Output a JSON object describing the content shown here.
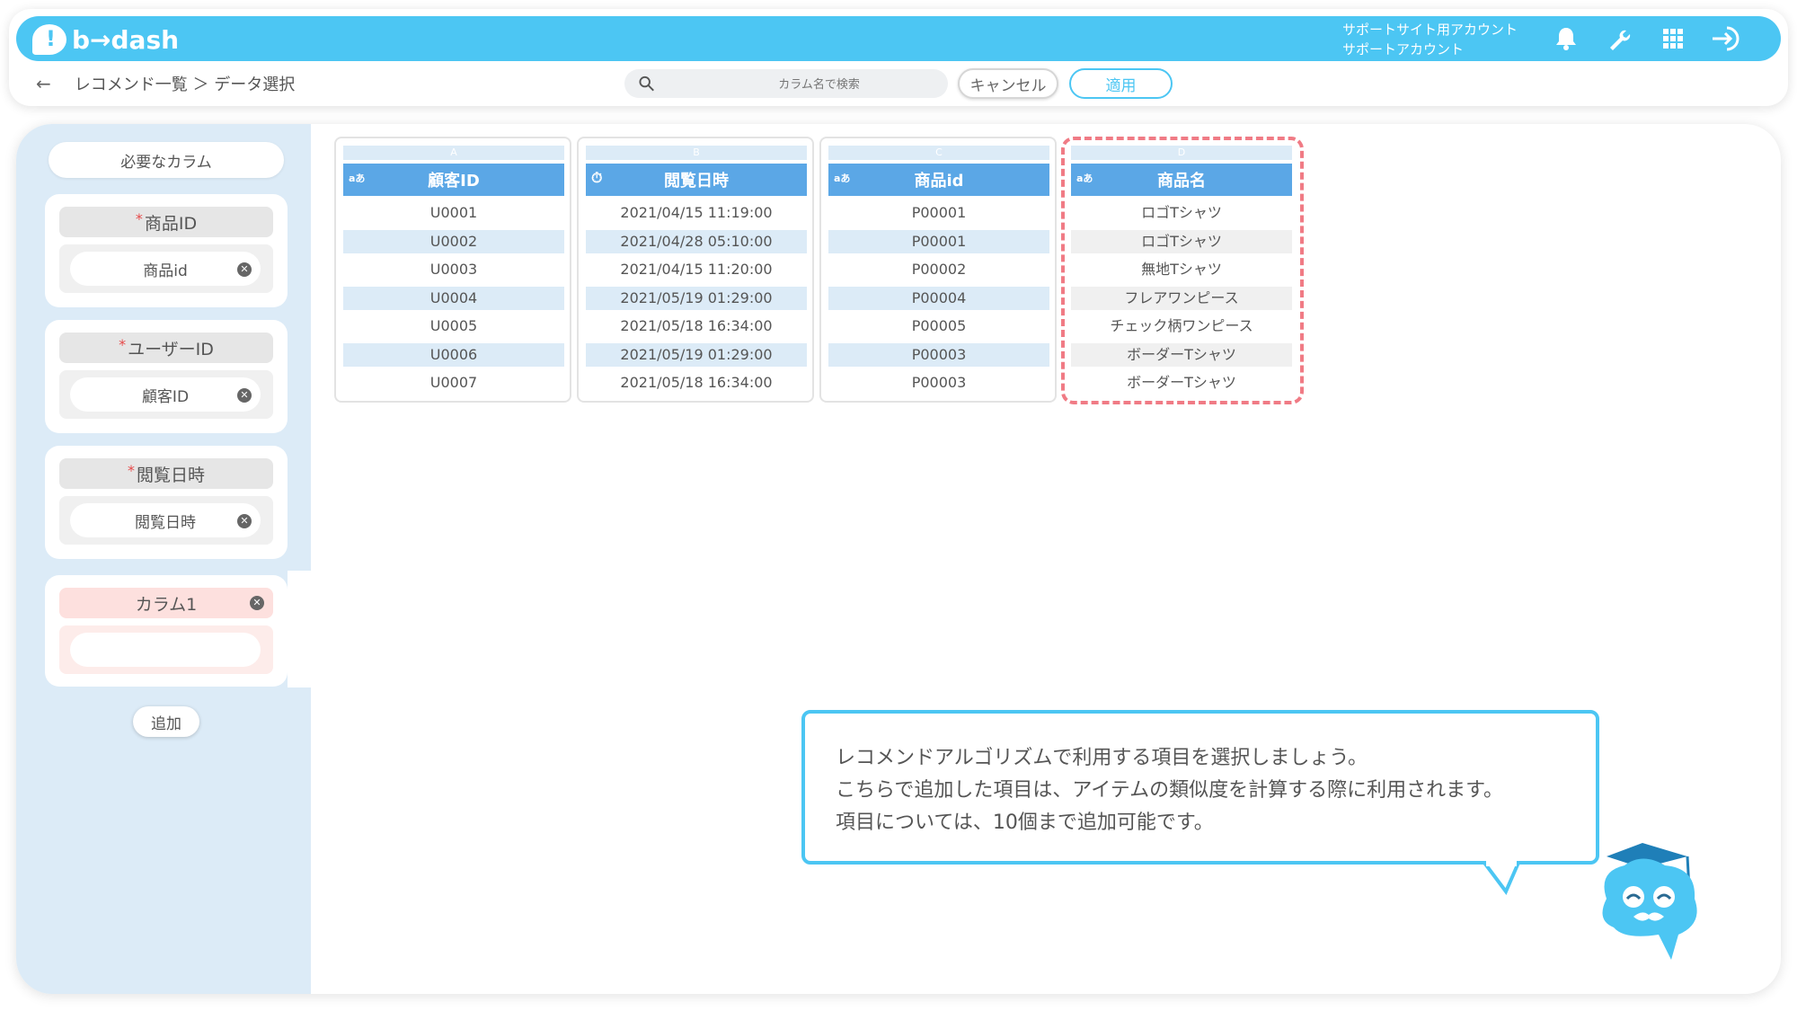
{
  "app": {
    "logo_text": "b→dash"
  },
  "header": {
    "account_line1": "サポートサイト用アカウント",
    "account_line2": "サポートアカウント"
  },
  "breadcrumb": {
    "path": "レコメンド一覧 ＞ データ選択"
  },
  "search": {
    "placeholder": "カラム名で検索"
  },
  "actions": {
    "cancel": "キャンセル",
    "apply": "適用"
  },
  "sidebar": {
    "required_title": "必要なカラム",
    "cards": [
      {
        "asterisk": "*",
        "title": "商品ID",
        "value": "商品id"
      },
      {
        "asterisk": "*",
        "title": "ユーザーID",
        "value": "顧客ID"
      },
      {
        "asterisk": "*",
        "title": "閲覧日時",
        "value": "閲覧日時"
      }
    ],
    "custom_card": {
      "title": "カラム1",
      "value": ""
    },
    "add_label": "追加"
  },
  "columns": [
    {
      "letter": "A",
      "type": "aあ",
      "header": "顧客ID",
      "rows": [
        "U0001",
        "U0002",
        "U0003",
        "U0004",
        "U0005",
        "U0006",
        "U0007"
      ]
    },
    {
      "letter": "B",
      "type": "⏱",
      "header": "閲覧日時",
      "rows": [
        "2021/04/15 11:19:00",
        "2021/04/28 05:10:00",
        "2021/04/15 11:20:00",
        "2021/05/19 01:29:00",
        "2021/05/18 16:34:00",
        "2021/05/19 01:29:00",
        "2021/05/18 16:34:00"
      ]
    },
    {
      "letter": "C",
      "type": "aあ",
      "header": "商品id",
      "rows": [
        "P00001",
        "P00001",
        "P00002",
        "P00004",
        "P00005",
        "P00003",
        "P00003"
      ]
    },
    {
      "letter": "D",
      "type": "aあ",
      "header": "商品名",
      "rows": [
        "ロゴTシャツ",
        "ロゴTシャツ",
        "無地Tシャツ",
        "フレアワンピース",
        "チェック柄ワンピース",
        "ボーダーTシャツ",
        "ボーダーTシャツ"
      ]
    }
  ],
  "tooltip": {
    "line1": "レコメンドアルゴリズムで利用する項目を選択しましょう。",
    "line2": "こちらで追加した項目は、アイテムの類似度を計算する際に利用されます。",
    "line3": "項目については、10個まで追加可能です。"
  },
  "icons": {
    "bell": "bell-icon",
    "wrench": "wrench-icon",
    "apps": "grid-icon",
    "logout": "logout-icon",
    "search": "search-icon",
    "back": "back-arrow-icon"
  },
  "colors": {
    "brand": "#4cc6f3",
    "column_header": "#5ba7e6",
    "highlight": "#f07b85"
  }
}
